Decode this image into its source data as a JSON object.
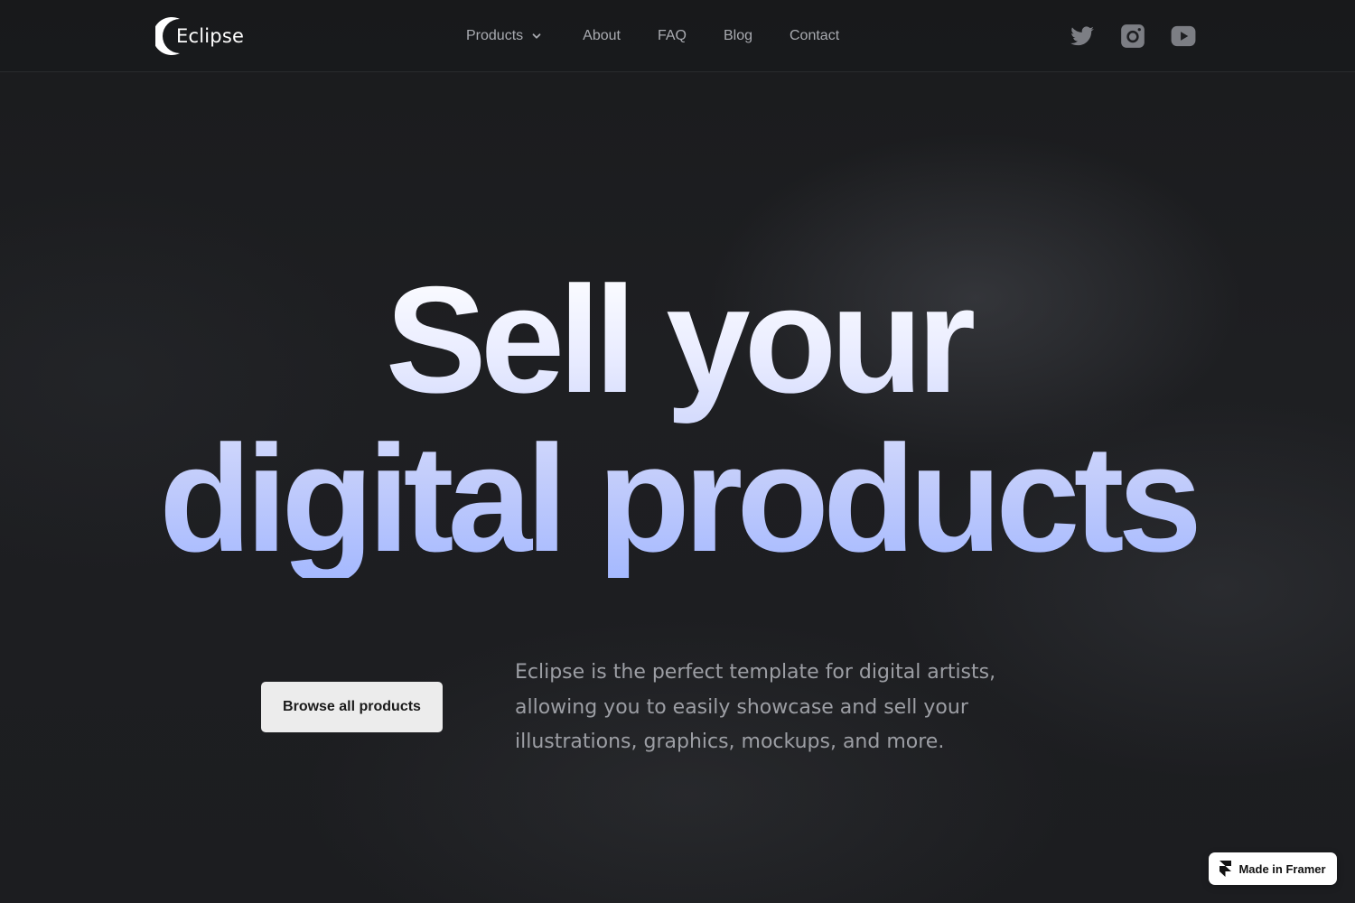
{
  "header": {
    "logo_text": "Eclipse",
    "nav": {
      "products": "Products",
      "about": "About",
      "faq": "FAQ",
      "blog": "Blog",
      "contact": "Contact"
    },
    "socials": [
      "twitter-icon",
      "instagram-icon",
      "youtube-icon"
    ]
  },
  "hero": {
    "headline_line1": "Sell your",
    "headline_line2": "digital products",
    "cta_label": "Browse all products",
    "description": "Eclipse is the perfect template for digital artists, allowing you to easily showcase and sell your illustrations, graphics, mockups, and more."
  },
  "badge": {
    "label": "Made in Framer"
  },
  "colors": {
    "background": "#1c1d20",
    "nav_text": "#a9abb1",
    "headline_top": "#ffffff",
    "headline_bottom": "#a5b9ff",
    "cta_bg": "#ececec",
    "description_text": "#9c9ea4"
  }
}
